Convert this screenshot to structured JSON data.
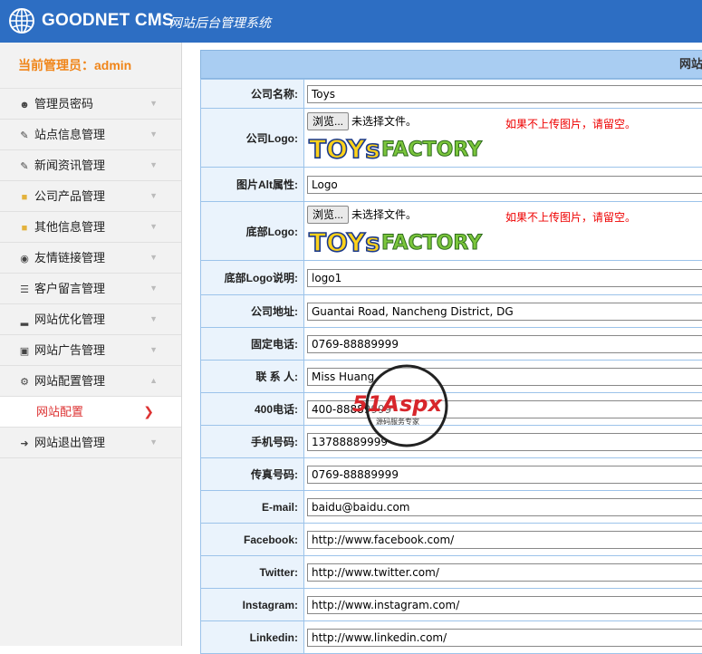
{
  "header": {
    "brand": "GOODNET CMS",
    "subtitle": "网站后台管理系统",
    "accent": "#2d6ec3"
  },
  "sidebar": {
    "admin_label": "当前管理员：admin",
    "items": [
      {
        "label": "管理员密码",
        "icon": "user-icon"
      },
      {
        "label": "站点信息管理",
        "icon": "edit-icon"
      },
      {
        "label": "新闻资讯管理",
        "icon": "edit-icon"
      },
      {
        "label": "公司产品管理",
        "icon": "folder-icon"
      },
      {
        "label": "其他信息管理",
        "icon": "folder-icon"
      },
      {
        "label": "友情链接管理",
        "icon": "globe-icon"
      },
      {
        "label": "客户留言管理",
        "icon": "list-icon"
      },
      {
        "label": "网站优化管理",
        "icon": "bar-chart-icon"
      },
      {
        "label": "网站广告管理",
        "icon": "monitor-icon"
      },
      {
        "label": "网站配置管理",
        "icon": "gear-icon"
      },
      {
        "label": "网站退出管理",
        "icon": "logout-icon"
      }
    ],
    "subitem": "网站配置"
  },
  "form": {
    "title": "网站配置",
    "file_button": "浏览...",
    "file_none": "未选择文件。",
    "upload_hint": "如果不上传图片，请留空。",
    "logo_text_toys": "TOYs",
    "logo_text_factory": "FACTORY",
    "rows": {
      "company_name": {
        "label": "公司名称:",
        "value": "Toys"
      },
      "company_logo": {
        "label": "公司Logo:"
      },
      "image_alt": {
        "label": "图片Alt属性:",
        "value": "Logo"
      },
      "footer_logo": {
        "label": "底部Logo:"
      },
      "footer_logo_desc": {
        "label": "底部Logo说明:",
        "value": "logo1"
      },
      "address": {
        "label": "公司地址:",
        "value": "Guantai Road, Nancheng District, DG"
      },
      "phone": {
        "label": "固定电话:",
        "value": "0769-88889999"
      },
      "contact": {
        "label": "联 系 人:",
        "value": "Miss Huang"
      },
      "hotline": {
        "label": "400电话:",
        "value": "400-88889999"
      },
      "mobile": {
        "label": "手机号码:",
        "value": "13788889999"
      },
      "fax": {
        "label": "传真号码:",
        "value": "0769-88889999"
      },
      "email": {
        "label": "E-mail:",
        "value": "baidu@baidu.com"
      },
      "facebook": {
        "label": "Facebook:",
        "value": "http://www.facebook.com/"
      },
      "twitter": {
        "label": "Twitter:",
        "value": "http://www.twitter.com/"
      },
      "instagram": {
        "label": "Instagram:",
        "value": "http://www.instagram.com/"
      },
      "linkedin": {
        "label": "Linkedin:",
        "value": "http://www.linkedin.com/"
      }
    }
  },
  "watermark": {
    "main": "51Aspx",
    "sub": "源码服务专家"
  }
}
